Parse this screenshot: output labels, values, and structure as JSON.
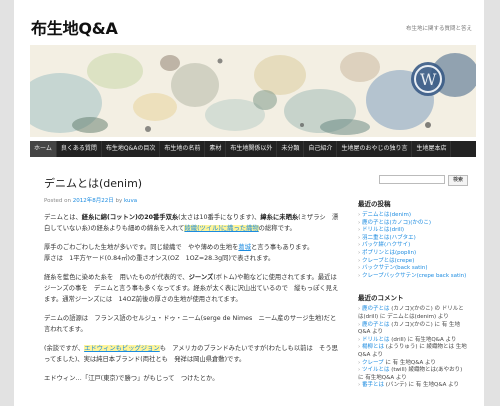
{
  "site": {
    "title": "布生地Q&A",
    "tagline": "布生地に関する質問と答え"
  },
  "nav": {
    "items": [
      "ホーム",
      "良くある質問",
      "布生地Q&Aの目次",
      "布生地の名前",
      "素材",
      "布生地関係以外",
      "未分類",
      "自己紹介",
      "生地屋のおやじの独り言",
      "生地屋本店"
    ]
  },
  "post": {
    "title": "デニムとは(denim)",
    "posted_label": "Posted on",
    "posted_date": "2012年8月22日",
    "by_label": "by",
    "author": "kuva",
    "p1": {
      "t1": "デニムとは、",
      "b1": "経糸に綿(コットン)の20番手双糸",
      "t2": "(太さは10番手になります)、",
      "b2": "緯糸に未晒糸",
      "t3": "(ミザラシ　漂白していない糸)の経糸よりも細めの綿糸を入れて",
      "link": "綾織(ツイル)に織った織物",
      "t4": "の総称です。"
    },
    "p2": {
      "t1": "厚手のごわごわした生地が多いです。同じ綾織で　やや薄めの生地を",
      "link": "葛城",
      "t2": "と言う事もあります。",
      "t3": "厚さは　1平方ヤード(0.84㎡)の重さオンス(OZ　1OZ=28.3g同)で表されます。"
    },
    "p3": {
      "t1": "経糸を藍色に染めた糸を　用いたものが代表的で、",
      "b1": "ジーンズ",
      "t2": "(ボトム)や鞄などに使用されてます。最近はジーンズの事を　デニムと言う事も多くなってます。経糸が太く表に沢山出ているので　縦もっぽく見えます。通常ジーンズには　14OZ前後の厚さの生地が使用されてます。"
    },
    "p4": "デニムの語源は　フランス語のセルジュ・ドゥ・ニーム(serge de Nimes　ニーム産のサージ生地)だと言われてます。",
    "p5": {
      "t1": "(余談ですが、",
      "link": "エドウィンもビッグジョン",
      "t2": "も　アメリカのブランドみたいですが(わたしも以前は　そう思ってました)、実は純日本ブランド(両社とも　発祥は岡山県倉敷)です。"
    },
    "p6": "エドウィン…「江戸(東京)で勝つ」がもじって　つけたとか。"
  },
  "sidebar": {
    "search_button": "検索",
    "search_value": "",
    "recent_posts_title": "最近の投稿",
    "recent_posts": [
      "デニムとは(denim)",
      "鹿の子とは(カノコ)(かのこ)",
      "ドリルとは(drill)",
      "羽二重とは(ハブタエ)",
      "パッケ絣(ハクサイ)",
      "ポプリンとは(poplin)",
      "クレープとは(crepe)",
      "バックサテン(back satin)",
      "クレープバックサテン(crepe back satin)"
    ],
    "recent_comments_title": "最近のコメント",
    "recent_comments": [
      {
        "who": "鹿の子とは",
        "text": "(カノコ)(かのこ) の  ドリルとは(drill) に デニムとは(denim) より"
      },
      {
        "who": "鹿の子とは",
        "text": "(カノコ)(かのこ) に 有 生地Q&A より"
      },
      {
        "who": "ドリルとは",
        "text": "(drill) に 有生地Q&A より"
      },
      {
        "who": "楊柳とは",
        "text": "(ようりゅう) に 綾織物とは 生地Q&A より"
      },
      {
        "who": "クレープ",
        "text": "に 有 生地Q&A より"
      },
      {
        "who": "ツイルとは",
        "text": "(twill) 綾織物とは(あやおり) に 有生地Q&A より"
      },
      {
        "who": "番手とは",
        "text": "(バンテ) に 有 生地Q&A より"
      }
    ]
  }
}
